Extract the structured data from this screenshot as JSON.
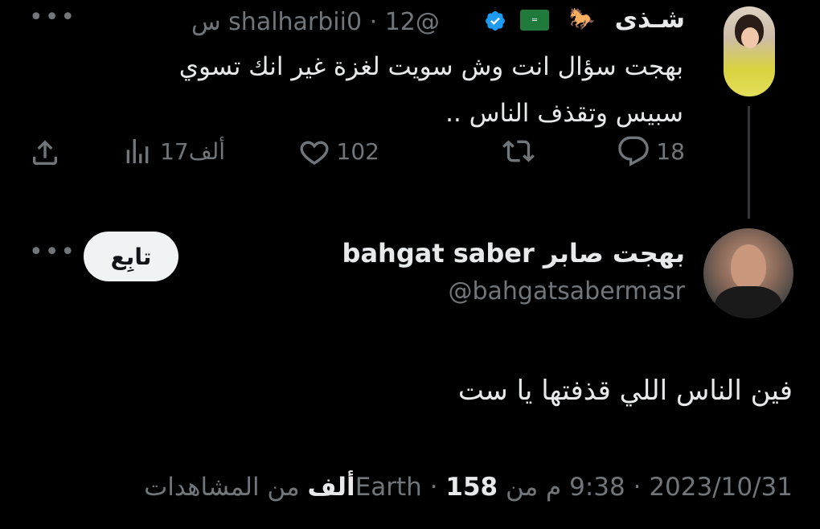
{
  "parent_tweet": {
    "display_name": "شـذى",
    "handle": "@shalharbii0",
    "time_ago": "12 س",
    "text": "بهجت سؤال انت وش سويت لغزة غير انك تسوي سبيس وتقذف الناس ..",
    "actions": {
      "replies": "18",
      "retweets": "",
      "likes": "102",
      "views": "17ألف"
    },
    "flag_label": "Saudi flag",
    "emoji_label": "horse"
  },
  "main_tweet": {
    "display_name": "bahgat saber بهجت صابر",
    "handle": "@bahgatsabermasr",
    "follow_label": "تابِع",
    "text": "فين الناس اللي قذفتها يا ست",
    "meta": {
      "date": "2023/10/31",
      "time": "9:38 م",
      "location": "من Earth",
      "views_count": "158ألف",
      "views_label": "من المشاهدات",
      "separator": "·"
    }
  },
  "colors": {
    "background": "#000000",
    "text_primary": "#e7e9ea",
    "text_secondary": "#71767b",
    "verified": "#1d9bf0",
    "follow_bg": "#eff3f4"
  }
}
